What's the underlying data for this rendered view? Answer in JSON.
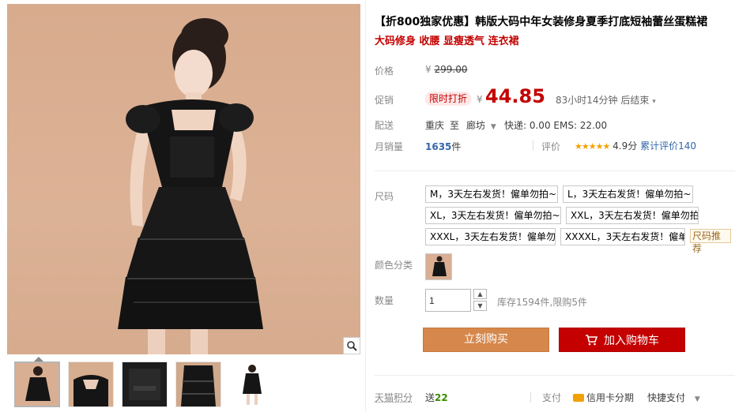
{
  "product": {
    "title": "【折800独家优惠】韩版大码中年女装修身夏季打底短袖蕾丝蛋糕裙",
    "subtitle": "大码修身 收腰 显瘦透气 连衣裙"
  },
  "price": {
    "label": "价格",
    "currency": "¥",
    "original": "299.00"
  },
  "promo": {
    "label": "促销",
    "tag": "限时打折",
    "currency": "¥",
    "price": "44.85",
    "countdown": "83小时14分钟 后结束"
  },
  "delivery": {
    "label": "配送",
    "from": "重庆",
    "to_word": "至",
    "to": "廊坊",
    "fees": "快递: 0.00 EMS: 22.00"
  },
  "sales": {
    "label": "月销量",
    "count": "1635",
    "unit": "件",
    "rating_label": "评价",
    "stars": "★★★★★",
    "score": "4.9分",
    "review_text": "累计评价",
    "review_count": "140"
  },
  "sizes": {
    "label": "尺码",
    "options": [
      "M，3天左右发货！僱单勿拍~",
      "L，3天左右发货！僱单勿拍~",
      "XL，3天左右发货！僱单勿拍~",
      "XXL，3天左右发货！僱单勿拍",
      "XXXL，3天左右发货！僱单勿",
      "XXXXL，3天左右发货！僱单"
    ],
    "recommend": "尺码推荐"
  },
  "color": {
    "label": "颜色分类"
  },
  "quantity": {
    "label": "数量",
    "value": "1",
    "stock": "库存1594件,限购5件"
  },
  "buttons": {
    "buy": "立刻购买",
    "cart": "加入购物车"
  },
  "footer": {
    "points_label": "天猫积分",
    "points_prefix": "送",
    "points_value": "22",
    "pay_label": "支付",
    "credit": "信用卡分期",
    "quick_pay": "快捷支付"
  },
  "colors": {
    "accent_red": "#c40000",
    "buy_orange": "#d6874b",
    "star_gold": "#f5a000"
  }
}
